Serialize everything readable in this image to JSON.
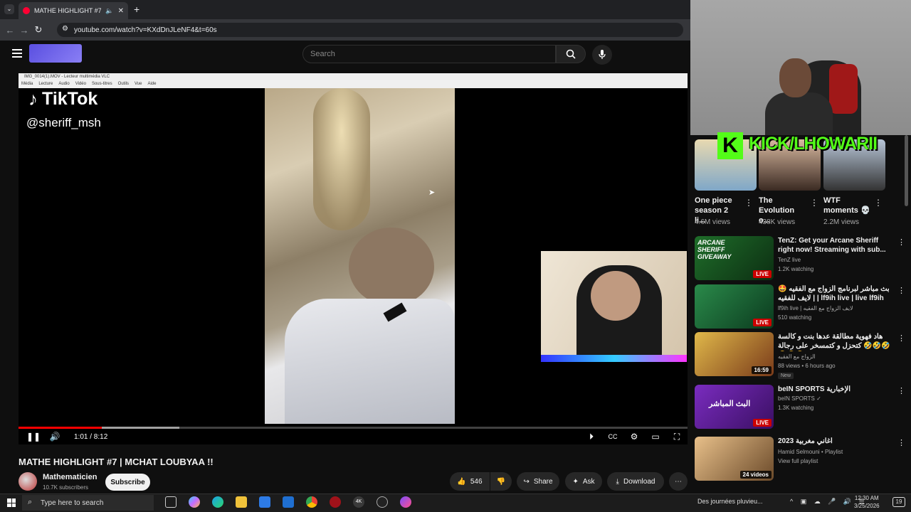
{
  "browser": {
    "tab_title": "MATHE HIGHLIGHT #7 | MC",
    "url": "youtube.com/watch?v=KXdDnJLeNF4&t=60s"
  },
  "youtube": {
    "search_placeholder": "Search"
  },
  "player": {
    "vlc_title": "IMG_0014(1).MOV - Lecteur multimédia VLC",
    "vlc_menu": [
      "Média",
      "Lecture",
      "Audio",
      "Vidéo",
      "Sous-titres",
      "Outils",
      "Vue",
      "Aide"
    ],
    "tiktok_logo": "TikTok",
    "tiktok_user": "@sheriff_msh",
    "time_display": "1:01 / 8:12",
    "progress_played": 0.124,
    "progress_buffered": 0.24
  },
  "video": {
    "title": "MATHE HIGHLIGHT #7 | MCHAT LOUBYAA !!",
    "channel": "Mathematicien",
    "subscribers": "10.7K subscribers",
    "subscribe_label": "Subscribe",
    "likes": "546",
    "share_label": "Share",
    "ask_label": "Ask",
    "download_label": "Download"
  },
  "overlay": {
    "kick_text": "KICK/LHOWARII",
    "kick_letter": "K"
  },
  "shorts": [
    {
      "title": "One piece season 2 li...",
      "views": "4.6M views"
    },
    {
      "title": "The Evolution o...",
      "views": "438K views"
    },
    {
      "title": "WTF moments 💀",
      "views": "2.2M views"
    }
  ],
  "recommendations": [
    {
      "title": "TenZ: Get your Arcane Sheriff right now! Streaming with sub...",
      "channel": "TenZ live",
      "meta": "1.2K watching",
      "badge": "LIVE",
      "thumb_color": "#2a5d2a",
      "thumb_text": "ARCANE SHERIFF GIVEAWAY"
    },
    {
      "title": "🤩 بث مباشر لبرنامج الزواج مع الفقيه | لايف للفقيه | lf9ih live | live lf9ih",
      "channel": "lf9ih live | لايف الزواج مع الفقيه",
      "meta": "510 watching",
      "badge": "LIVE",
      "thumb_color": "#1e6b3a",
      "thumb_text": ""
    },
    {
      "title": "هاد فهوية مطالقة عدها بنت و كالسة كتحزل و كتمسخر على رجالة 🤣🤣🤣🤣🤣🤣",
      "channel": "الزواج مع الفقيه",
      "meta": "88 views • 6 hours ago",
      "badge": "16:59",
      "new": "New",
      "thumb_color": "#c9a23a",
      "thumb_text": ""
    },
    {
      "title": "beIN SPORTS الإخبارية",
      "channel": "beIN SPORTS ✓",
      "meta": "1.3K watching",
      "badge": "LIVE",
      "thumb_color": "#5b1f8c",
      "thumb_text": "البث المباشر"
    },
    {
      "title": "اغاني مغربية 2023",
      "channel": "Hamid Selmouni • Playlist",
      "meta": "View full playlist",
      "badge": "24 videos",
      "thumb_color": "#c48a4a",
      "thumb_text": ""
    }
  ],
  "taskbar": {
    "search_placeholder": "Type here to search",
    "weather": "Des journées pluvieu...",
    "time": "12:30 AM",
    "date": "3/25/2026",
    "notif_count": "19"
  }
}
